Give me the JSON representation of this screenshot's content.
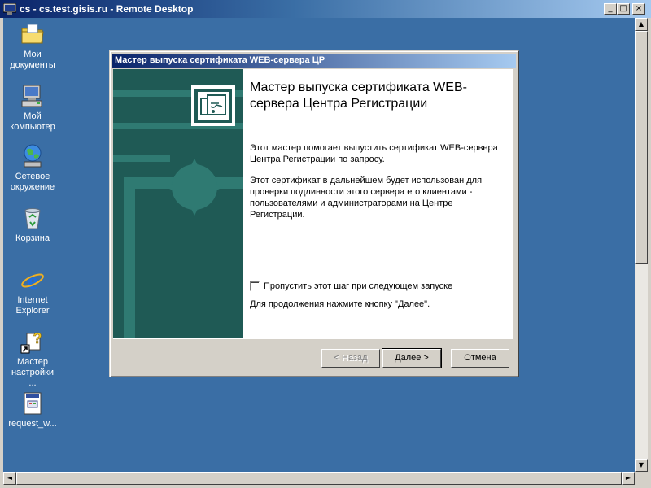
{
  "window": {
    "title": "cs - cs.test.gisis.ru - Remote Desktop",
    "minimize": "_",
    "maximize": "□",
    "close": "×"
  },
  "desktop_icons": [
    {
      "label": "Мои документы",
      "icon": "my-documents-folder-icon"
    },
    {
      "label": "Мой компьютер",
      "icon": "my-computer-icon"
    },
    {
      "label": "Сетевое окружение",
      "icon": "network-places-icon"
    },
    {
      "label": "Корзина",
      "icon": "recycle-bin-icon"
    },
    {
      "label": "Internet Explorer",
      "icon": "internet-explorer-icon"
    },
    {
      "label": "Мастер настройки ...",
      "icon": "setup-wizard-shortcut-icon"
    },
    {
      "label": "request_w...",
      "icon": "document-file-icon"
    }
  ],
  "wizard": {
    "title": "Мастер выпуска сертификата WEB-сервера ЦР",
    "heading": "Мастер выпуска сертификата WEB-сервера Центра Регистрации",
    "para1": "Этот мастер помогает выпустить сертификат WEB-сервера Центра Регистрации по запросу.",
    "para2": "Этот сертификат в дальнейшем будет использован для проверки подлинности этого сервера его клиентами  - пользователями и администраторами на Центре Регистрации.",
    "checkbox_label": "Пропустить этот шаг при следующем запуске",
    "checkbox_checked": false,
    "continue_hint": "Для продолжения нажмите кнопку \"Далее\".",
    "back_label": "< Назад",
    "next_label": "Далее >",
    "cancel_label": "Отмена"
  },
  "scrollbars": {
    "up_arrow": "▲",
    "down_arrow": "▼",
    "left_arrow": "◄",
    "right_arrow": "►"
  },
  "colors": {
    "desktop": "#3a6ea5",
    "titlebar": "#0a246a",
    "wizard_side": "#1f5a55"
  }
}
